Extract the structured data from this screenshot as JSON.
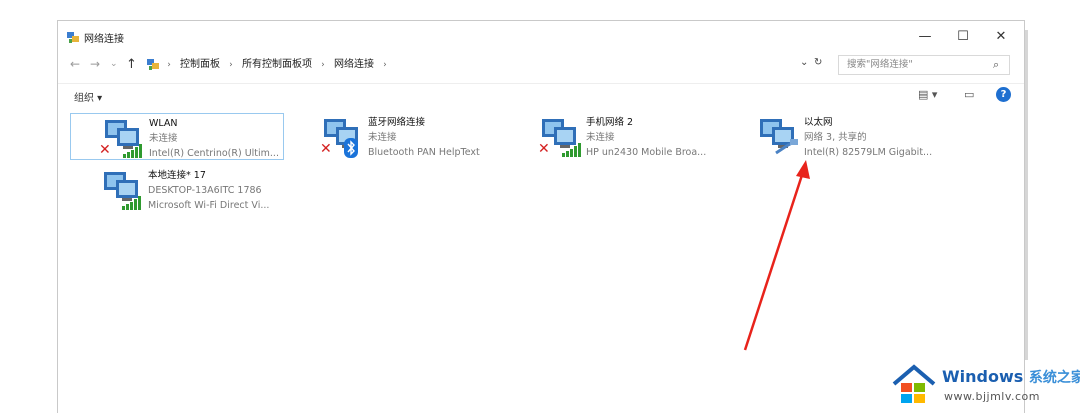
{
  "window": {
    "title": "网络连接",
    "minimize_label": "—",
    "maximize_label": "☐",
    "close_label": "✕"
  },
  "nav": {
    "back_label": "←",
    "forward_label": "→",
    "recent_label": "⌄",
    "up_label": "↑",
    "breadcrumbs": [
      "控制面板",
      "所有控制面板项",
      "网络连接"
    ],
    "sep": "›",
    "dropdown_label": "⌄",
    "refresh_label": "↻"
  },
  "search": {
    "placeholder": "搜索\"网络连接\"",
    "icon": "search-icon"
  },
  "toolbar": {
    "organize_label": "组织 ▾",
    "view_label": "▤ ▾",
    "pane_label": "▭",
    "help_label": "?"
  },
  "connections": [
    {
      "name": "WLAN",
      "status": "未连接",
      "device": "Intel(R) Centrino(R) Ultim...",
      "overlay": "wifi-signal",
      "error": true
    },
    {
      "name": "蓝牙网络连接",
      "status": "未连接",
      "device": "Bluetooth PAN HelpText",
      "overlay": "bluetooth",
      "error": true
    },
    {
      "name": "手机网络 2",
      "status": "未连接",
      "device": "HP un2430 Mobile Broa...",
      "overlay": "wifi-signal",
      "error": true
    },
    {
      "name": "以太网",
      "status": "网络 3, 共享的",
      "device": "Intel(R) 82579LM Gigabit...",
      "overlay": "cable",
      "error": false
    },
    {
      "name": "本地连接* 17",
      "status": "DESKTOP-13A6ITC 1786",
      "device": "Microsoft Wi-Fi Direct Vi...",
      "overlay": "wifi-signal",
      "error": false
    }
  ],
  "annotation": {
    "color": "#e8231b"
  },
  "watermark": {
    "brand": "Windows",
    "brand_cn": "系统之家",
    "url": "www.bjjmlv.com"
  },
  "colors": {
    "accent": "#1e6fd0",
    "selection": "#99c9ef",
    "error_red": "#d42020",
    "signal_green": "#2f9a2f"
  }
}
